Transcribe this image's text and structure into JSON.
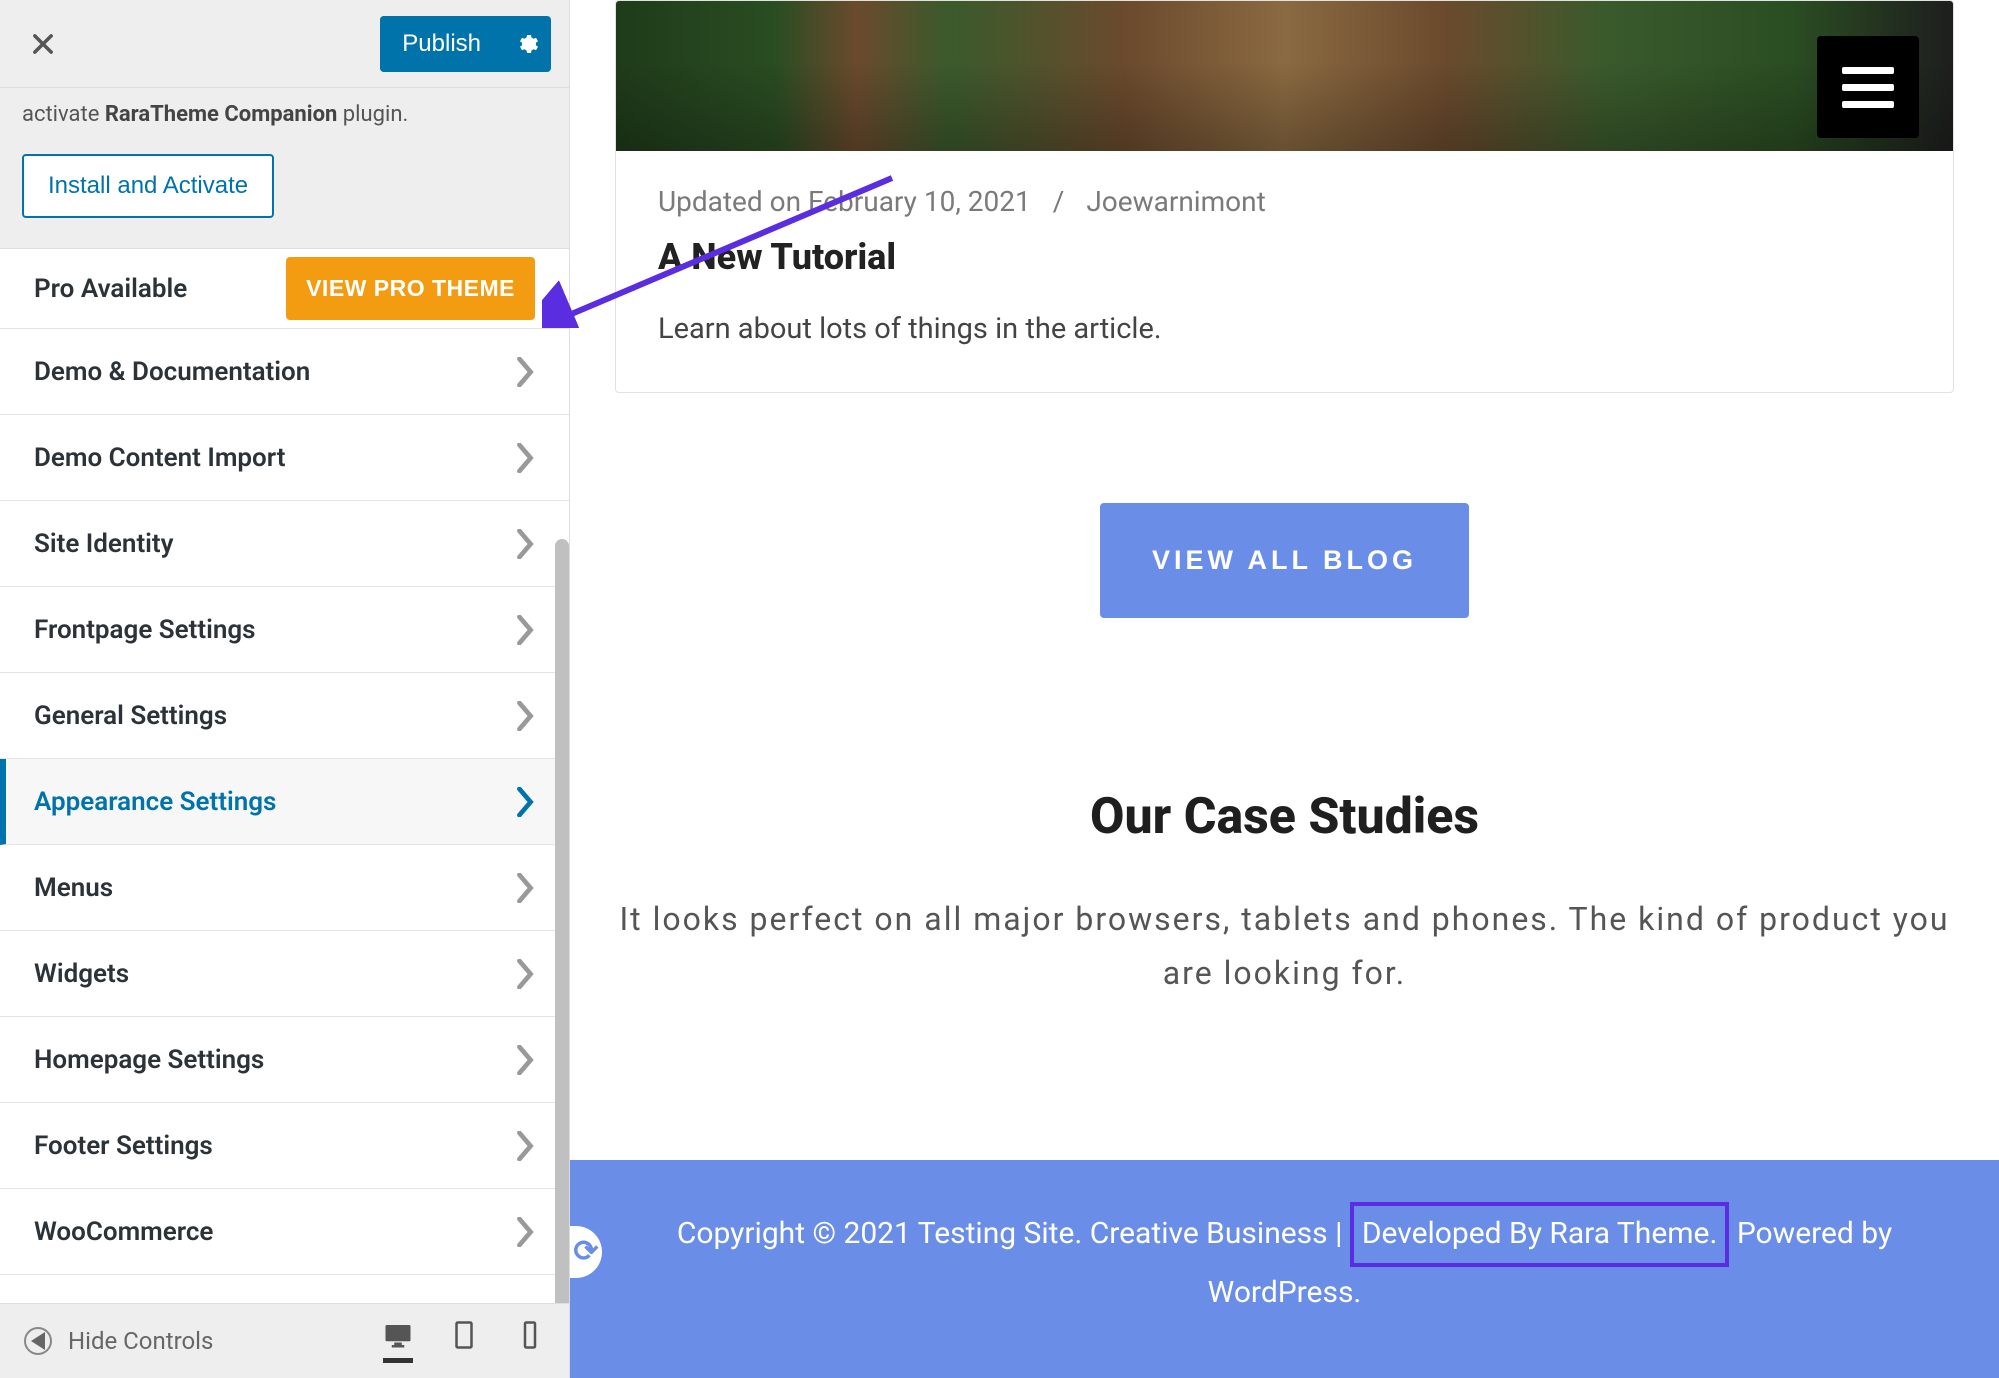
{
  "top": {
    "publish_label": "Publish"
  },
  "notice": {
    "prefix": "activate ",
    "bold": "RaraTheme Companion",
    "suffix": " plugin.",
    "install_label": "Install and Activate"
  },
  "pro_row": {
    "label": "Pro Available",
    "button": "VIEW PRO THEME"
  },
  "panels": [
    {
      "label": "Demo & Documentation"
    },
    {
      "label": "Demo Content Import"
    },
    {
      "label": "Site Identity"
    },
    {
      "label": "Frontpage Settings"
    },
    {
      "label": "General Settings"
    },
    {
      "label": "Appearance Settings",
      "active": true
    },
    {
      "label": "Menus"
    },
    {
      "label": "Widgets"
    },
    {
      "label": "Homepage Settings"
    },
    {
      "label": "Footer Settings"
    },
    {
      "label": "WooCommerce"
    }
  ],
  "bottom": {
    "hide_controls": "Hide Controls"
  },
  "post": {
    "meta_updated": "Updated on February 10, 2021",
    "meta_sep": "/",
    "meta_author": "Joewarnimont",
    "title": "A New Tutorial",
    "excerpt": "Learn about lots of things in the article."
  },
  "view_all_label": "VIEW ALL BLOG",
  "case": {
    "title": "Our Case Studies",
    "subtitle": "It looks perfect on all major browsers, tablets and phones. The kind of product you are looking for."
  },
  "footer": {
    "part1": "Copyright © 2021 Testing Site. Creative Business  | ",
    "highlight": "Developed By Rara Theme.",
    "part2": " Powered by WordPress."
  }
}
